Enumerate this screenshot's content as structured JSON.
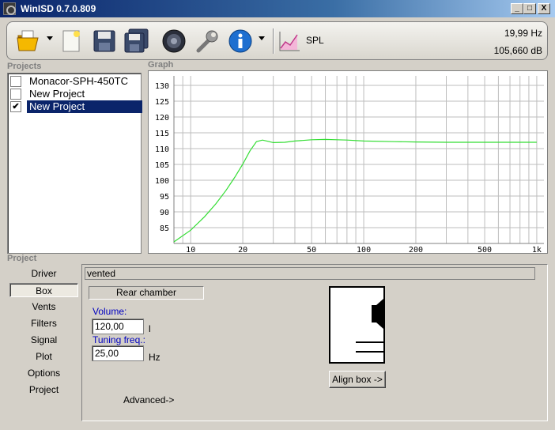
{
  "window": {
    "title": "WinISD 0.7.0.809",
    "min": "_",
    "max": "□",
    "close": "X"
  },
  "toolbar": {
    "spl_label": "SPL",
    "readout_freq": "19,99 Hz",
    "readout_db": "105,660 dB",
    "icons": [
      "open-folder-icon",
      "new-document-icon",
      "save-icon",
      "save-all-icon",
      "speaker-icon",
      "wrench-icon",
      "info-icon",
      "spl-graph-icon"
    ]
  },
  "projects": {
    "label": "Projects",
    "items": [
      {
        "name": "Monacor-SPH-450TC",
        "checked": false,
        "selected": false
      },
      {
        "name": "New Project",
        "checked": false,
        "selected": false
      },
      {
        "name": "New Project",
        "checked": true,
        "selected": true
      }
    ]
  },
  "graph": {
    "label": "Graph",
    "line_color": "#33dd33"
  },
  "chart_data": {
    "type": "line",
    "title": "",
    "xlabel": "",
    "ylabel": "",
    "x_scale": "log",
    "xlim": [
      8,
      1100
    ],
    "ylim": [
      80,
      133
    ],
    "x_ticks": [
      10,
      20,
      50,
      100,
      200,
      500,
      1000
    ],
    "x_tick_labels": [
      "10",
      "20",
      "50",
      "100",
      "200",
      "500",
      "1k"
    ],
    "y_ticks": [
      85,
      90,
      95,
      100,
      105,
      110,
      115,
      120,
      125,
      130
    ],
    "grid": true,
    "series": [
      {
        "x": [
          8,
          10,
          12,
          14,
          16,
          18,
          20,
          22,
          24,
          26,
          28,
          30,
          35,
          40,
          50,
          60,
          70,
          80,
          100,
          150,
          200,
          300,
          500,
          1000
        ],
        "y": [
          80.5,
          84.2,
          88.4,
          92.6,
          96.8,
          101.0,
          105.1,
          109.3,
          112.2,
          112.7,
          112.3,
          111.9,
          112.0,
          112.4,
          112.8,
          112.9,
          112.8,
          112.7,
          112.4,
          112.2,
          112.1,
          112.0,
          112.0,
          112.0
        ]
      }
    ]
  },
  "project_section": {
    "label": "Project",
    "tabs": [
      "Driver",
      "Box",
      "Vents",
      "Filters",
      "Signal",
      "Plot",
      "Options",
      "Project"
    ],
    "active_tab": "Box"
  },
  "box": {
    "type": "vented",
    "rear_chamber": "Rear chamber",
    "volume_label": "Volume:",
    "volume_value": "120,00",
    "volume_unit": "l",
    "tuning_label": "Tuning freq.:",
    "tuning_value": "25,00",
    "tuning_unit": "Hz",
    "align_button": "Align box ->",
    "advanced": "Advanced->"
  }
}
